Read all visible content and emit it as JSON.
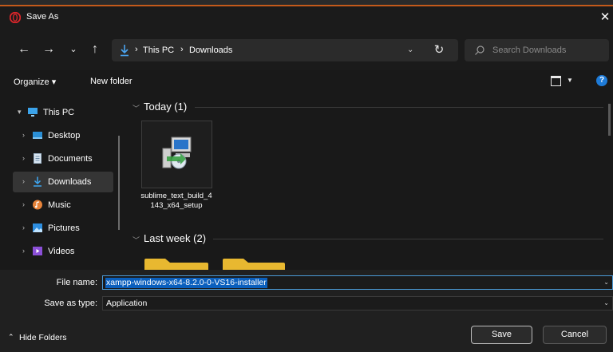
{
  "window": {
    "title": "Save As"
  },
  "address": {
    "crumbs": [
      "This PC",
      "Downloads"
    ],
    "search_placeholder": "Search Downloads"
  },
  "toolbar": {
    "organize": "Organize ▾",
    "new_folder": "New folder",
    "help": "?"
  },
  "sidebar": {
    "items": [
      {
        "label": "This PC",
        "icon": "monitor-icon",
        "chevron": "▾"
      },
      {
        "label": "Desktop",
        "icon": "desktop-icon",
        "chevron": "›"
      },
      {
        "label": "Documents",
        "icon": "documents-icon",
        "chevron": "›"
      },
      {
        "label": "Downloads",
        "icon": "download-icon",
        "chevron": "›",
        "selected": true
      },
      {
        "label": "Music",
        "icon": "music-icon",
        "chevron": "›"
      },
      {
        "label": "Pictures",
        "icon": "pictures-icon",
        "chevron": "›"
      },
      {
        "label": "Videos",
        "icon": "videos-icon",
        "chevron": "›"
      }
    ]
  },
  "content": {
    "groups": [
      {
        "label": "Today (1)"
      },
      {
        "label": "Last week (2)"
      }
    ],
    "files": [
      {
        "name": "sublime_text_build_4143_x64_setup",
        "icon": "installer-icon"
      }
    ]
  },
  "save": {
    "file_name_label": "File name:",
    "file_name_value": "xampp-windows-x64-8.2.0-0-VS16-installer",
    "type_label": "Save as type:",
    "type_value": "Application",
    "hide_folders": "Hide Folders",
    "save_button": "Save",
    "cancel_button": "Cancel"
  },
  "colors": {
    "background": "#191919",
    "accent_blue": "#0a5fbd",
    "opera_red": "#e0262b",
    "folder_yellow": "#e8b830"
  }
}
